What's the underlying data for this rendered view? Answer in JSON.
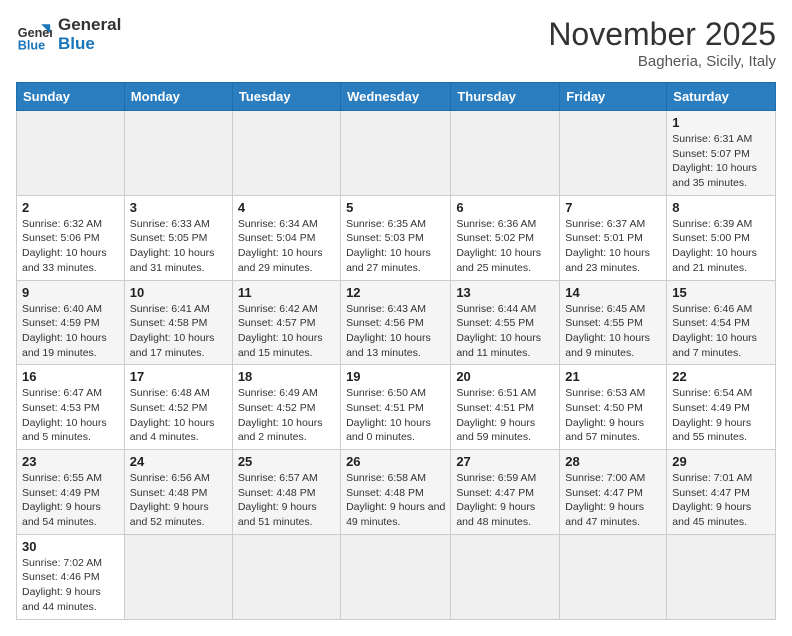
{
  "header": {
    "logo_general": "General",
    "logo_blue": "Blue",
    "month_title": "November 2025",
    "location": "Bagheria, Sicily, Italy"
  },
  "weekdays": [
    "Sunday",
    "Monday",
    "Tuesday",
    "Wednesday",
    "Thursday",
    "Friday",
    "Saturday"
  ],
  "weeks": [
    [
      {
        "day": "",
        "info": ""
      },
      {
        "day": "",
        "info": ""
      },
      {
        "day": "",
        "info": ""
      },
      {
        "day": "",
        "info": ""
      },
      {
        "day": "",
        "info": ""
      },
      {
        "day": "",
        "info": ""
      },
      {
        "day": "1",
        "info": "Sunrise: 6:31 AM\nSunset: 5:07 PM\nDaylight: 10 hours and 35 minutes."
      }
    ],
    [
      {
        "day": "2",
        "info": "Sunrise: 6:32 AM\nSunset: 5:06 PM\nDaylight: 10 hours and 33 minutes."
      },
      {
        "day": "3",
        "info": "Sunrise: 6:33 AM\nSunset: 5:05 PM\nDaylight: 10 hours and 31 minutes."
      },
      {
        "day": "4",
        "info": "Sunrise: 6:34 AM\nSunset: 5:04 PM\nDaylight: 10 hours and 29 minutes."
      },
      {
        "day": "5",
        "info": "Sunrise: 6:35 AM\nSunset: 5:03 PM\nDaylight: 10 hours and 27 minutes."
      },
      {
        "day": "6",
        "info": "Sunrise: 6:36 AM\nSunset: 5:02 PM\nDaylight: 10 hours and 25 minutes."
      },
      {
        "day": "7",
        "info": "Sunrise: 6:37 AM\nSunset: 5:01 PM\nDaylight: 10 hours and 23 minutes."
      },
      {
        "day": "8",
        "info": "Sunrise: 6:39 AM\nSunset: 5:00 PM\nDaylight: 10 hours and 21 minutes."
      }
    ],
    [
      {
        "day": "9",
        "info": "Sunrise: 6:40 AM\nSunset: 4:59 PM\nDaylight: 10 hours and 19 minutes."
      },
      {
        "day": "10",
        "info": "Sunrise: 6:41 AM\nSunset: 4:58 PM\nDaylight: 10 hours and 17 minutes."
      },
      {
        "day": "11",
        "info": "Sunrise: 6:42 AM\nSunset: 4:57 PM\nDaylight: 10 hours and 15 minutes."
      },
      {
        "day": "12",
        "info": "Sunrise: 6:43 AM\nSunset: 4:56 PM\nDaylight: 10 hours and 13 minutes."
      },
      {
        "day": "13",
        "info": "Sunrise: 6:44 AM\nSunset: 4:55 PM\nDaylight: 10 hours and 11 minutes."
      },
      {
        "day": "14",
        "info": "Sunrise: 6:45 AM\nSunset: 4:55 PM\nDaylight: 10 hours and 9 minutes."
      },
      {
        "day": "15",
        "info": "Sunrise: 6:46 AM\nSunset: 4:54 PM\nDaylight: 10 hours and 7 minutes."
      }
    ],
    [
      {
        "day": "16",
        "info": "Sunrise: 6:47 AM\nSunset: 4:53 PM\nDaylight: 10 hours and 5 minutes."
      },
      {
        "day": "17",
        "info": "Sunrise: 6:48 AM\nSunset: 4:52 PM\nDaylight: 10 hours and 4 minutes."
      },
      {
        "day": "18",
        "info": "Sunrise: 6:49 AM\nSunset: 4:52 PM\nDaylight: 10 hours and 2 minutes."
      },
      {
        "day": "19",
        "info": "Sunrise: 6:50 AM\nSunset: 4:51 PM\nDaylight: 10 hours and 0 minutes."
      },
      {
        "day": "20",
        "info": "Sunrise: 6:51 AM\nSunset: 4:51 PM\nDaylight: 9 hours and 59 minutes."
      },
      {
        "day": "21",
        "info": "Sunrise: 6:53 AM\nSunset: 4:50 PM\nDaylight: 9 hours and 57 minutes."
      },
      {
        "day": "22",
        "info": "Sunrise: 6:54 AM\nSunset: 4:49 PM\nDaylight: 9 hours and 55 minutes."
      }
    ],
    [
      {
        "day": "23",
        "info": "Sunrise: 6:55 AM\nSunset: 4:49 PM\nDaylight: 9 hours and 54 minutes."
      },
      {
        "day": "24",
        "info": "Sunrise: 6:56 AM\nSunset: 4:48 PM\nDaylight: 9 hours and 52 minutes."
      },
      {
        "day": "25",
        "info": "Sunrise: 6:57 AM\nSunset: 4:48 PM\nDaylight: 9 hours and 51 minutes."
      },
      {
        "day": "26",
        "info": "Sunrise: 6:58 AM\nSunset: 4:48 PM\nDaylight: 9 hours and 49 minutes."
      },
      {
        "day": "27",
        "info": "Sunrise: 6:59 AM\nSunset: 4:47 PM\nDaylight: 9 hours and 48 minutes."
      },
      {
        "day": "28",
        "info": "Sunrise: 7:00 AM\nSunset: 4:47 PM\nDaylight: 9 hours and 47 minutes."
      },
      {
        "day": "29",
        "info": "Sunrise: 7:01 AM\nSunset: 4:47 PM\nDaylight: 9 hours and 45 minutes."
      }
    ],
    [
      {
        "day": "30",
        "info": "Sunrise: 7:02 AM\nSunset: 4:46 PM\nDaylight: 9 hours and 44 minutes."
      },
      {
        "day": "",
        "info": ""
      },
      {
        "day": "",
        "info": ""
      },
      {
        "day": "",
        "info": ""
      },
      {
        "day": "",
        "info": ""
      },
      {
        "day": "",
        "info": ""
      },
      {
        "day": "",
        "info": ""
      }
    ]
  ]
}
